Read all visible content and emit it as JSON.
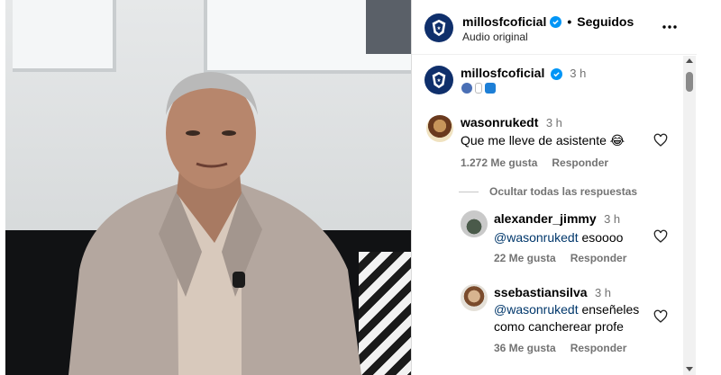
{
  "header": {
    "username": "millosfcoficial",
    "separator": "•",
    "follow_state": "Seguidos",
    "audio": "Audio original"
  },
  "caption": {
    "username": "millosfcoficial",
    "time": "3 h"
  },
  "comments": [
    {
      "username": "wasonrukedt",
      "time": "3 h",
      "text": "Que me lleve de asistente 😂",
      "likes": "1.272 Me gusta",
      "reply": "Responder"
    }
  ],
  "hide_replies": "Ocultar todas las respuestas",
  "replies": [
    {
      "username": "alexander_jimmy",
      "time": "3 h",
      "mention": "@wasonrukedt",
      "text": " esoooo",
      "likes": "22 Me gusta",
      "reply": "Responder"
    },
    {
      "username": "ssebastiansilva",
      "time": "3 h",
      "mention": "@wasonrukedt",
      "text": " enseñeles",
      "text2": "como cancherear profe",
      "likes": "36 Me gusta",
      "reply": "Responder"
    }
  ],
  "colors": {
    "brand_navy": "#0f2f6b",
    "verified_blue": "#0095f6",
    "mention_blue": "#00376b",
    "muted_text": "#737373"
  },
  "icons": {
    "more": "more-options-icon",
    "verified": "verified-badge-icon",
    "heart": "heart-outline-icon",
    "crest": "club-crest-icon"
  }
}
